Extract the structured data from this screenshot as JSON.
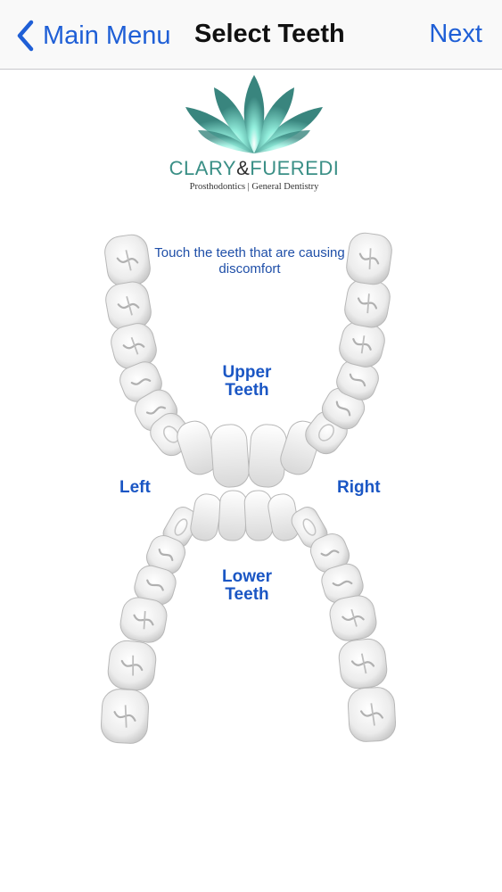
{
  "nav": {
    "back_label": "Main Menu",
    "title": "Select Teeth",
    "next_label": "Next"
  },
  "logo": {
    "brand_part1": "CLARY",
    "brand_amp": "&",
    "brand_part2": "FUEREDI",
    "tagline": "Prosthodontics | General Dentistry",
    "colors": {
      "lotus_dark": "#2f7f78",
      "lotus_light": "#6fd8c6",
      "text": "#3a8f86"
    }
  },
  "chart": {
    "instruction": "Touch the teeth that are causing discomfort",
    "upper_label": "Upper Teeth",
    "lower_label": "Lower Teeth",
    "left_label": "Left",
    "right_label": "Right"
  },
  "colors": {
    "accent": "#1f5fd6",
    "label_blue": "#1a56c4",
    "tooth": "#eeeeee"
  }
}
